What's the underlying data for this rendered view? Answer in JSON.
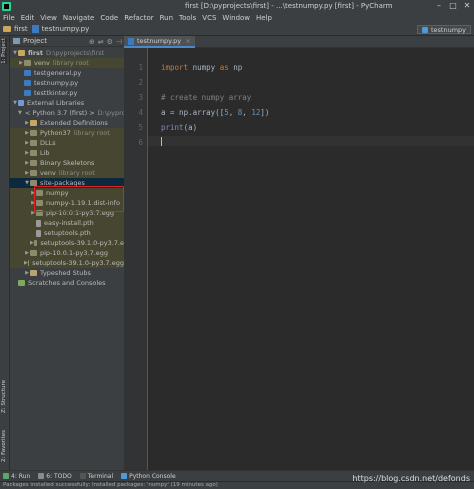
{
  "window": {
    "title": "first [D:\\pyprojects\\first] - ...\\testnumpy.py [first] - PyCharm",
    "minimize": "–",
    "maximize": "□",
    "close": "✕"
  },
  "menu": [
    "File",
    "Edit",
    "View",
    "Navigate",
    "Code",
    "Refactor",
    "Run",
    "Tools",
    "VCS",
    "Window",
    "Help"
  ],
  "navbar": {
    "project": "first",
    "file": "testnumpy.py",
    "run_config": "testnumpy"
  },
  "left_strip": {
    "project_tab": "1: Project",
    "structure_tab": "Z: Structure",
    "favorites_tab": "2: Favorites"
  },
  "project_panel": {
    "title": "Project",
    "tree": [
      {
        "label": "first",
        "hint": "D:\\pyprojects\\first"
      },
      {
        "label": "venv",
        "hint": "library root"
      },
      {
        "label": "testgeneral.py",
        "hint": ""
      },
      {
        "label": "testnumpy.py",
        "hint": ""
      },
      {
        "label": "testtkinter.py",
        "hint": ""
      },
      {
        "label": "External Libraries",
        "hint": ""
      },
      {
        "label": "< Python 3.7 (first) >",
        "hint": "D:\\pypro"
      },
      {
        "label": "Extended Definitions",
        "hint": ""
      },
      {
        "label": "Python37",
        "hint": "library root"
      },
      {
        "label": "DLLs",
        "hint": ""
      },
      {
        "label": "Lib",
        "hint": ""
      },
      {
        "label": "Binary Skeletons",
        "hint": ""
      },
      {
        "label": "venv",
        "hint": "library root"
      },
      {
        "label": "site-packages",
        "hint": ""
      },
      {
        "label": "numpy",
        "hint": ""
      },
      {
        "label": "numpy-1.19.1.dist-info",
        "hint": ""
      },
      {
        "label": "pip-10.0.1-py3.7.egg",
        "hint": ""
      },
      {
        "label": "easy-install.pth",
        "hint": ""
      },
      {
        "label": "setuptools.pth",
        "hint": ""
      },
      {
        "label": "setuptools-39.1.0-py3.7.e",
        "hint": ""
      },
      {
        "label": "pip-10.0.1-py3.7.egg",
        "hint": ""
      },
      {
        "label": "setuptools-39.1.0-py3.7.egg",
        "hint": ""
      },
      {
        "label": "Typeshed Stubs",
        "hint": ""
      },
      {
        "label": "Scratches and Consoles",
        "hint": ""
      }
    ]
  },
  "editor": {
    "tab": "testnumpy.py",
    "line_numbers": [
      "1",
      "2",
      "3",
      "4",
      "5",
      "6"
    ],
    "code": {
      "l1_kw1": "import",
      "l1_mod": " numpy ",
      "l1_kw2": "as",
      "l1_alias": " np",
      "l3": "# create numpy array",
      "l4_pre": "a = np.array([",
      "l4_n1": "5",
      "l4_sep1": ", ",
      "l4_n2": "8",
      "l4_sep2": ", ",
      "l4_n3": "12",
      "l4_post": "])",
      "l5_fn": "print",
      "l5_args": "(a)"
    }
  },
  "bottom_tools": [
    "4: Run",
    "6: TODO",
    "Terminal",
    "Python Console"
  ],
  "status": "Packages installed successfully: Installed packages: 'numpy' (19 minutes ago)",
  "watermark": "https://blog.csdn.net/defonds"
}
